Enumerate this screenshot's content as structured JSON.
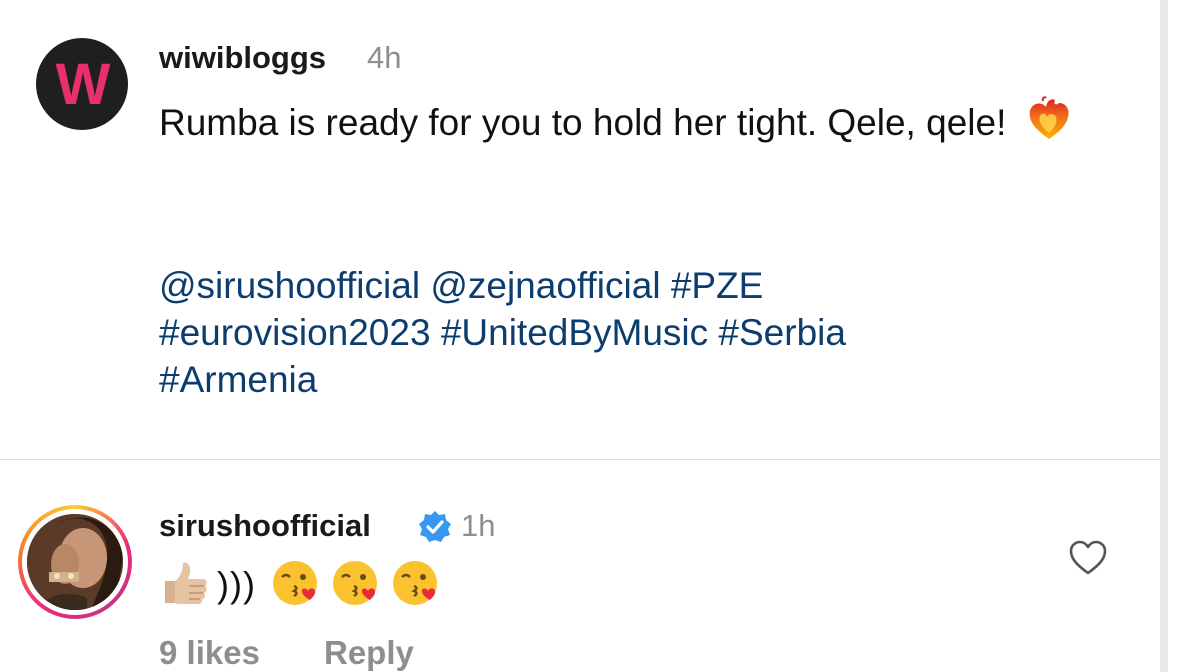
{
  "post": {
    "username": "wiwibloggs",
    "time": "4h",
    "avatar_letter": "W",
    "caption": "Rumba is ready for you to hold her tight. Qele, qele!",
    "emoji": "heart-on-fire-emoji",
    "tags_line1": "@sirushoofficial @zejnaofficial #PZE",
    "tags_line2": "#eurovision2023 #UnitedByMusic #Serbia",
    "tags_line3": "#Armenia"
  },
  "comment": {
    "username": "sirushoofficial",
    "verified": true,
    "time": "1h",
    "text": ")))",
    "emojis": [
      "thumbs-up-emoji",
      "face-blowing-kiss-emoji",
      "face-blowing-kiss-emoji",
      "face-blowing-kiss-emoji"
    ],
    "likes": "9 likes",
    "reply_label": "Reply"
  },
  "colors": {
    "hashtag": "#0d3d6e",
    "muted": "#8e8e8e",
    "brand_w": "#e8316b",
    "verified": "#3897f0"
  }
}
